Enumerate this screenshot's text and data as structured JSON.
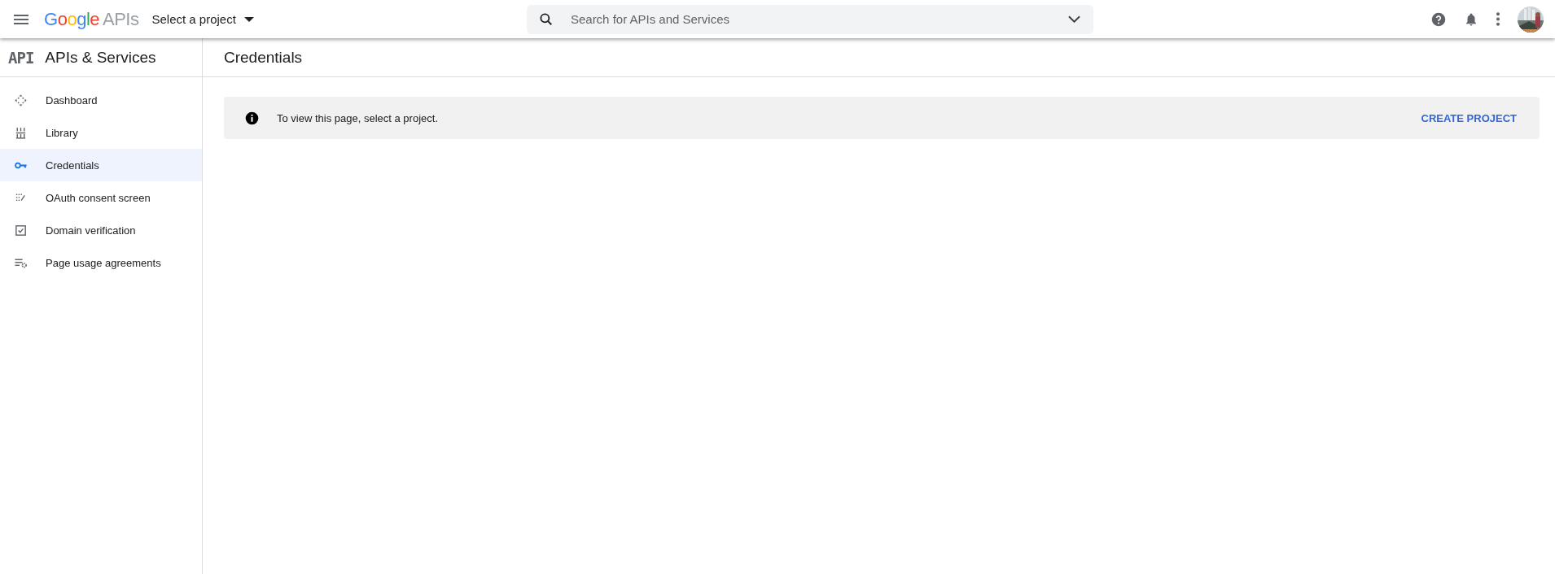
{
  "header": {
    "logo": {
      "brand": "Google",
      "product": "APIs"
    },
    "project_picker": "Select a project",
    "search": {
      "placeholder": "Search for APIs and Services"
    }
  },
  "sidebar": {
    "logo": "API",
    "title": "APIs & Services",
    "items": [
      {
        "label": "Dashboard",
        "selected": false
      },
      {
        "label": "Library",
        "selected": false
      },
      {
        "label": "Credentials",
        "selected": true
      },
      {
        "label": "OAuth consent screen",
        "selected": false
      },
      {
        "label": "Domain verification",
        "selected": false
      },
      {
        "label": "Page usage agreements",
        "selected": false
      }
    ]
  },
  "page": {
    "title": "Credentials",
    "notice": {
      "message": "To view this page, select a project.",
      "action": "CREATE PROJECT"
    }
  }
}
